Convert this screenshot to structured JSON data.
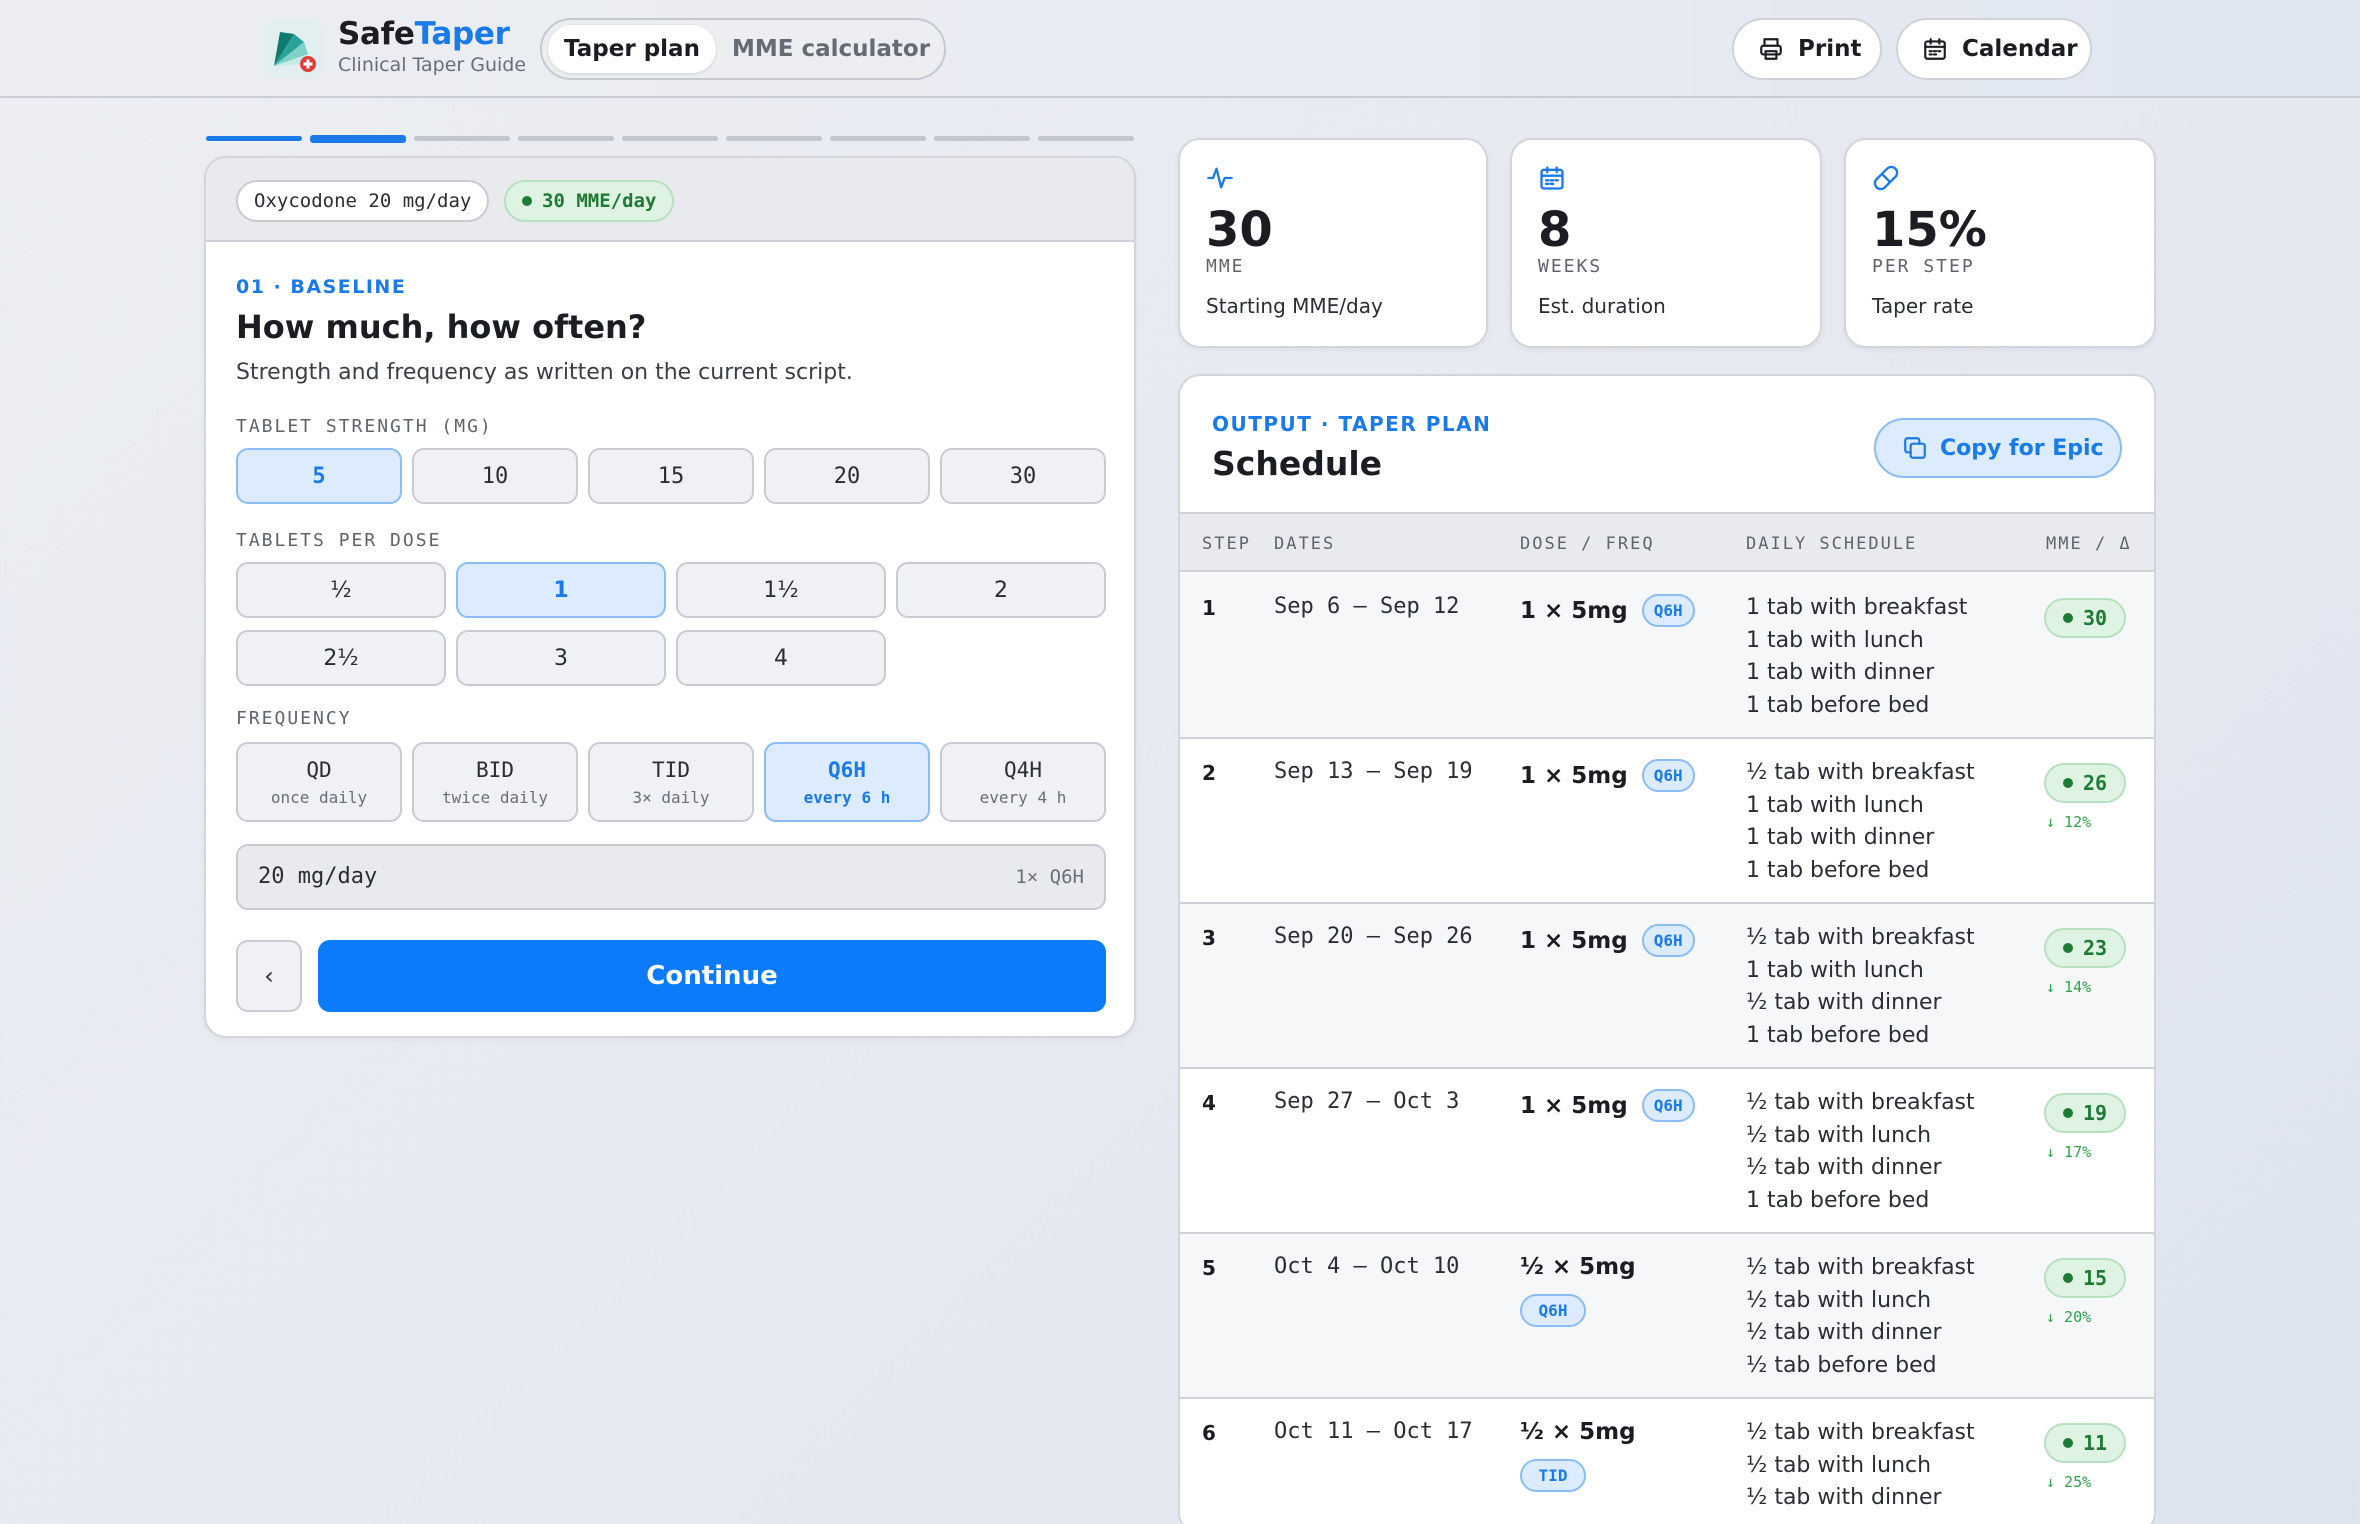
{
  "header": {
    "brand_part1": "Safe",
    "brand_part2": "Taper",
    "brand_sub": "Clinical Taper Guide",
    "tabs": [
      {
        "label": "Taper plan",
        "active": true
      },
      {
        "label": "MME calculator",
        "active": false
      }
    ],
    "print_label": "Print",
    "calendar_label": "Calendar"
  },
  "progress": {
    "total_steps": 9,
    "current_step": 2
  },
  "left": {
    "drug_pill": "Oxycodone 20 mg/day",
    "mme_pill": "30 MME/day",
    "kicker": "01 · BASELINE",
    "title": "How much, how often?",
    "description": "Strength and frequency as written on the current script.",
    "strength_label": "TABLET STRENGTH (MG)",
    "strengths": [
      "5",
      "10",
      "15",
      "20",
      "30"
    ],
    "strength_selected": "5",
    "tablets_label": "TABLETS PER DOSE",
    "tablets": [
      "½",
      "1",
      "1½",
      "2",
      "2½",
      "3",
      "4"
    ],
    "tablets_selected": "1",
    "frequency_label": "FREQUENCY",
    "frequencies": [
      {
        "code": "QD",
        "desc": "once daily"
      },
      {
        "code": "BID",
        "desc": "twice daily"
      },
      {
        "code": "TID",
        "desc": "3× daily"
      },
      {
        "code": "Q6H",
        "desc": "every 6 h"
      },
      {
        "code": "Q4H",
        "desc": "every 4 h"
      }
    ],
    "frequency_selected": "Q6H",
    "summary_value": "20 mg/day",
    "summary_sub": "1× Q6H",
    "back_label": "‹",
    "continue_label": "Continue"
  },
  "stats": [
    {
      "icon": "activity-icon",
      "value": "30",
      "unit": "MME",
      "label": "Starting MME/day"
    },
    {
      "icon": "calendar-icon",
      "value": "8",
      "unit": "WEEKS",
      "label": "Est. duration"
    },
    {
      "icon": "pill-icon",
      "value": "15%",
      "unit": "PER STEP",
      "label": "Taper rate"
    }
  ],
  "schedule": {
    "kicker": "OUTPUT · TAPER PLAN",
    "title": "Schedule",
    "copy_label": "Copy for Epic",
    "columns": [
      "STEP",
      "DATES",
      "DOSE / FREQ",
      "DAILY SCHEDULE",
      "MME / Δ"
    ],
    "rows": [
      {
        "step": "1",
        "dates": "Sep 6 – Sep 12",
        "dose": "1 × 5mg",
        "freq": "Q6H",
        "wrap": false,
        "lines": [
          "1 tab with breakfast",
          "1 tab with lunch",
          "1 tab with dinner",
          "1 tab before bed"
        ],
        "mme": "30",
        "delta": ""
      },
      {
        "step": "2",
        "dates": "Sep 13 – Sep 19",
        "dose": "1 × 5mg",
        "freq": "Q6H",
        "wrap": false,
        "lines": [
          "½ tab with breakfast",
          "1 tab with lunch",
          "1 tab with dinner",
          "1 tab before bed"
        ],
        "mme": "26",
        "delta": "↓ 12%"
      },
      {
        "step": "3",
        "dates": "Sep 20 – Sep 26",
        "dose": "1 × 5mg",
        "freq": "Q6H",
        "wrap": false,
        "lines": [
          "½ tab with breakfast",
          "1 tab with lunch",
          "½ tab with dinner",
          "1 tab before bed"
        ],
        "mme": "23",
        "delta": "↓ 14%"
      },
      {
        "step": "4",
        "dates": "Sep 27 – Oct 3",
        "dose": "1 × 5mg",
        "freq": "Q6H",
        "wrap": false,
        "lines": [
          "½ tab with breakfast",
          "½ tab with lunch",
          "½ tab with dinner",
          "1 tab before bed"
        ],
        "mme": "19",
        "delta": "↓ 17%"
      },
      {
        "step": "5",
        "dates": "Oct 4 – Oct 10",
        "dose": "½ × 5mg",
        "freq": "Q6H",
        "wrap": true,
        "lines": [
          "½ tab with breakfast",
          "½ tab with lunch",
          "½ tab with dinner",
          "½ tab before bed"
        ],
        "mme": "15",
        "delta": "↓ 20%"
      },
      {
        "step": "6",
        "dates": "Oct 11 – Oct 17",
        "dose": "½ × 5mg",
        "freq": "TID",
        "wrap": true,
        "lines": [
          "½ tab with breakfast",
          "½ tab with lunch",
          "½ tab with dinner"
        ],
        "mme": "11",
        "delta": "↓ 25%"
      }
    ]
  }
}
